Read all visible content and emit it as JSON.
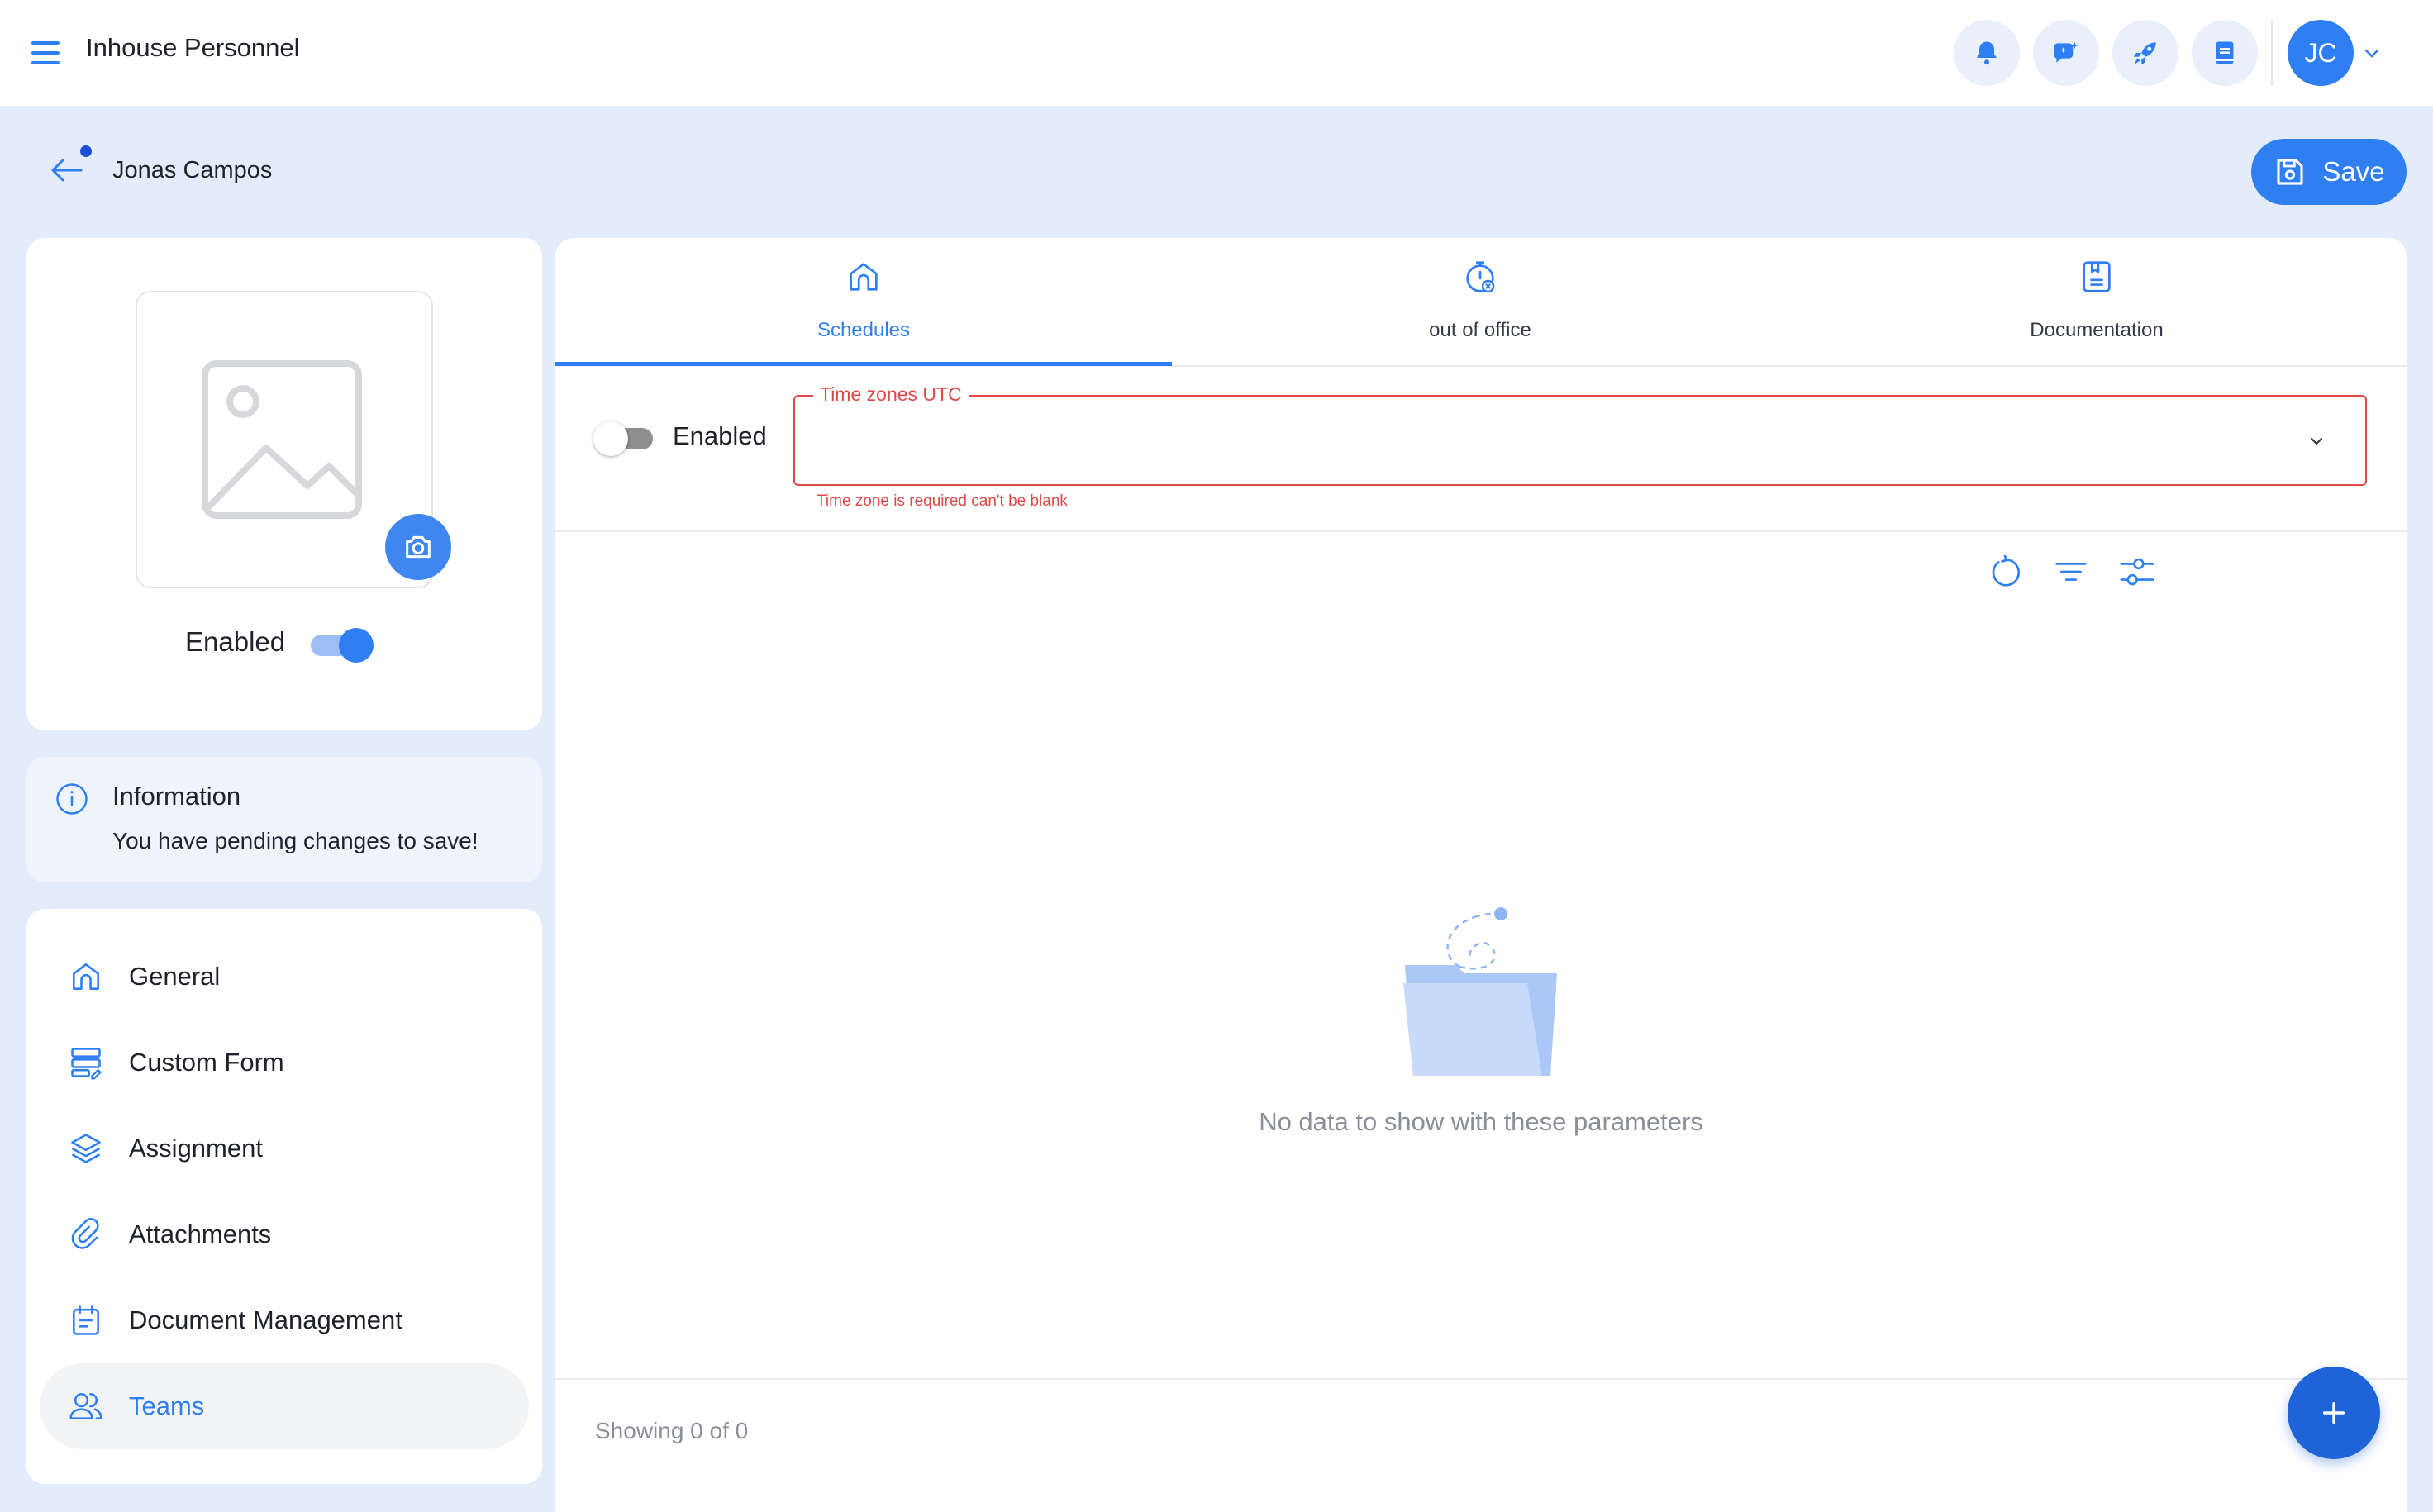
{
  "app": {
    "title": "Inhouse Personnel"
  },
  "header": {
    "icons": [
      "bell-icon",
      "chat-sparkle-icon",
      "rocket-icon",
      "book-icon"
    ],
    "user_initials": "JC"
  },
  "subheader": {
    "name": "Jonas Campos",
    "save_label": "Save"
  },
  "profile": {
    "enabled_label": "Enabled",
    "enabled": true
  },
  "info": {
    "title": "Information",
    "message": "You have pending changes to save!"
  },
  "nav": {
    "items": [
      {
        "label": "General",
        "icon": "home-icon"
      },
      {
        "label": "Custom Form",
        "icon": "form-icon"
      },
      {
        "label": "Assignment",
        "icon": "layers-icon"
      },
      {
        "label": "Attachments",
        "icon": "paperclip-icon"
      },
      {
        "label": "Document Management",
        "icon": "calendar-doc-icon"
      },
      {
        "label": "Teams",
        "icon": "users-icon",
        "active": true
      }
    ]
  },
  "tabs": [
    {
      "label": "Schedules",
      "icon": "home-icon",
      "active": true
    },
    {
      "label": "out of office",
      "icon": "timer-icon"
    },
    {
      "label": "Documentation",
      "icon": "document-icon"
    }
  ],
  "filters": {
    "enabled_label": "Enabled",
    "enabled": false,
    "timezone_legend": "Time zones UTC",
    "timezone_value": "",
    "timezone_error": "Time zone is required can't be blank"
  },
  "empty_state": {
    "message": "No data to show with these parameters"
  },
  "footer": {
    "showing": "Showing 0 of 0"
  },
  "colors": {
    "accent": "#2f7ff2",
    "background": "#e3ecfb",
    "error": "#e04848",
    "fab": "#1f63d8"
  }
}
